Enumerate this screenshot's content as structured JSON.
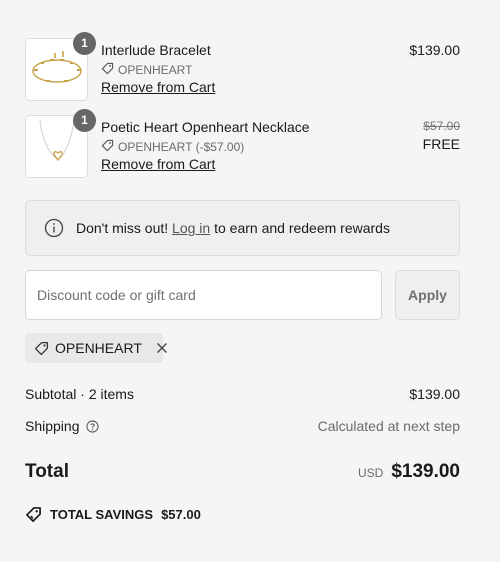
{
  "cart": {
    "items": [
      {
        "name": "Interlude Bracelet",
        "quantity": "1",
        "discount_tag": "OPENHEART",
        "remove_label": "Remove from Cart",
        "price": "$139.00"
      },
      {
        "name": "Poetic Heart Openheart Necklace",
        "quantity": "1",
        "discount_tag": "OPENHEART (-$57.00)",
        "remove_label": "Remove from Cart",
        "original_price": "$57.00",
        "price": "FREE"
      }
    ]
  },
  "rewards": {
    "prefix": "Don't miss out! ",
    "link": "Log in",
    "suffix": " to earn and redeem rewards"
  },
  "discount": {
    "placeholder": "Discount code or gift card",
    "value": "",
    "apply_label": "Apply",
    "applied_code": "OPENHEART"
  },
  "summary": {
    "subtotal_label": "Subtotal · 2 items",
    "subtotal_value": "$139.00",
    "shipping_label": "Shipping",
    "shipping_value": "Calculated at next step",
    "total_label": "Total",
    "currency": "USD",
    "total_value": "$139.00",
    "savings_label": "TOTAL SAVINGS",
    "savings_value": "$57.00"
  },
  "icons": {
    "tag": "tag-icon",
    "info": "info-icon",
    "help": "question-circle-icon",
    "close": "close-icon",
    "savings": "savings-tag-icon"
  }
}
